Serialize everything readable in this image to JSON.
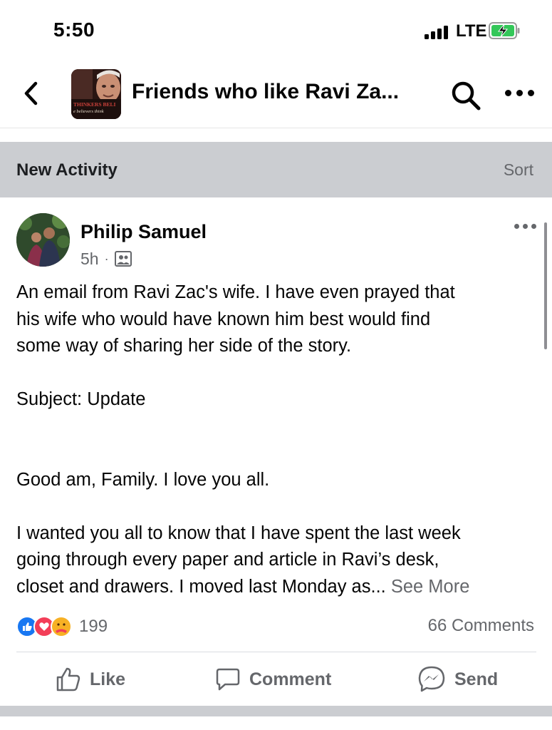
{
  "status_bar": {
    "time": "5:50",
    "network": "LTE",
    "battery_color": "#34c759"
  },
  "nav": {
    "title": "Friends who like Ravi Za...",
    "thumb_text": "THINKERS BELI",
    "thumb_subtext": "e believers think"
  },
  "section": {
    "title": "New Activity",
    "sort_label": "Sort"
  },
  "post": {
    "author": "Philip Samuel",
    "time": "5h",
    "separator": "·",
    "body_lines": [
      "An email from Ravi Zac's wife. I have even prayed that",
      "his wife who would have known him best would find",
      "some way of sharing her side of the story.",
      "",
      "Subject: Update",
      "",
      "",
      "Good am, Family. I love you all.",
      "",
      "I wanted you all to know that I have spent the last week",
      "going through every paper and article in Ravi’s desk,",
      "closet and drawers. I moved last Monday as... "
    ],
    "see_more": "See More",
    "reaction_count": "199",
    "comments_label": "66 Comments",
    "actions": {
      "like": "Like",
      "comment": "Comment",
      "send": "Send"
    }
  },
  "icons": {
    "back": "chevron-left-icon",
    "search": "search-icon",
    "more": "more-icon",
    "audience": "group-audience-icon",
    "like": "thumbs-up-icon",
    "comment": "comment-bubble-icon",
    "send": "messenger-icon"
  },
  "colors": {
    "accent": "#1877f2",
    "love": "#f33e58",
    "care": "#f7b125",
    "section_bg": "#cbcdd1",
    "muted_text": "#65676b"
  }
}
